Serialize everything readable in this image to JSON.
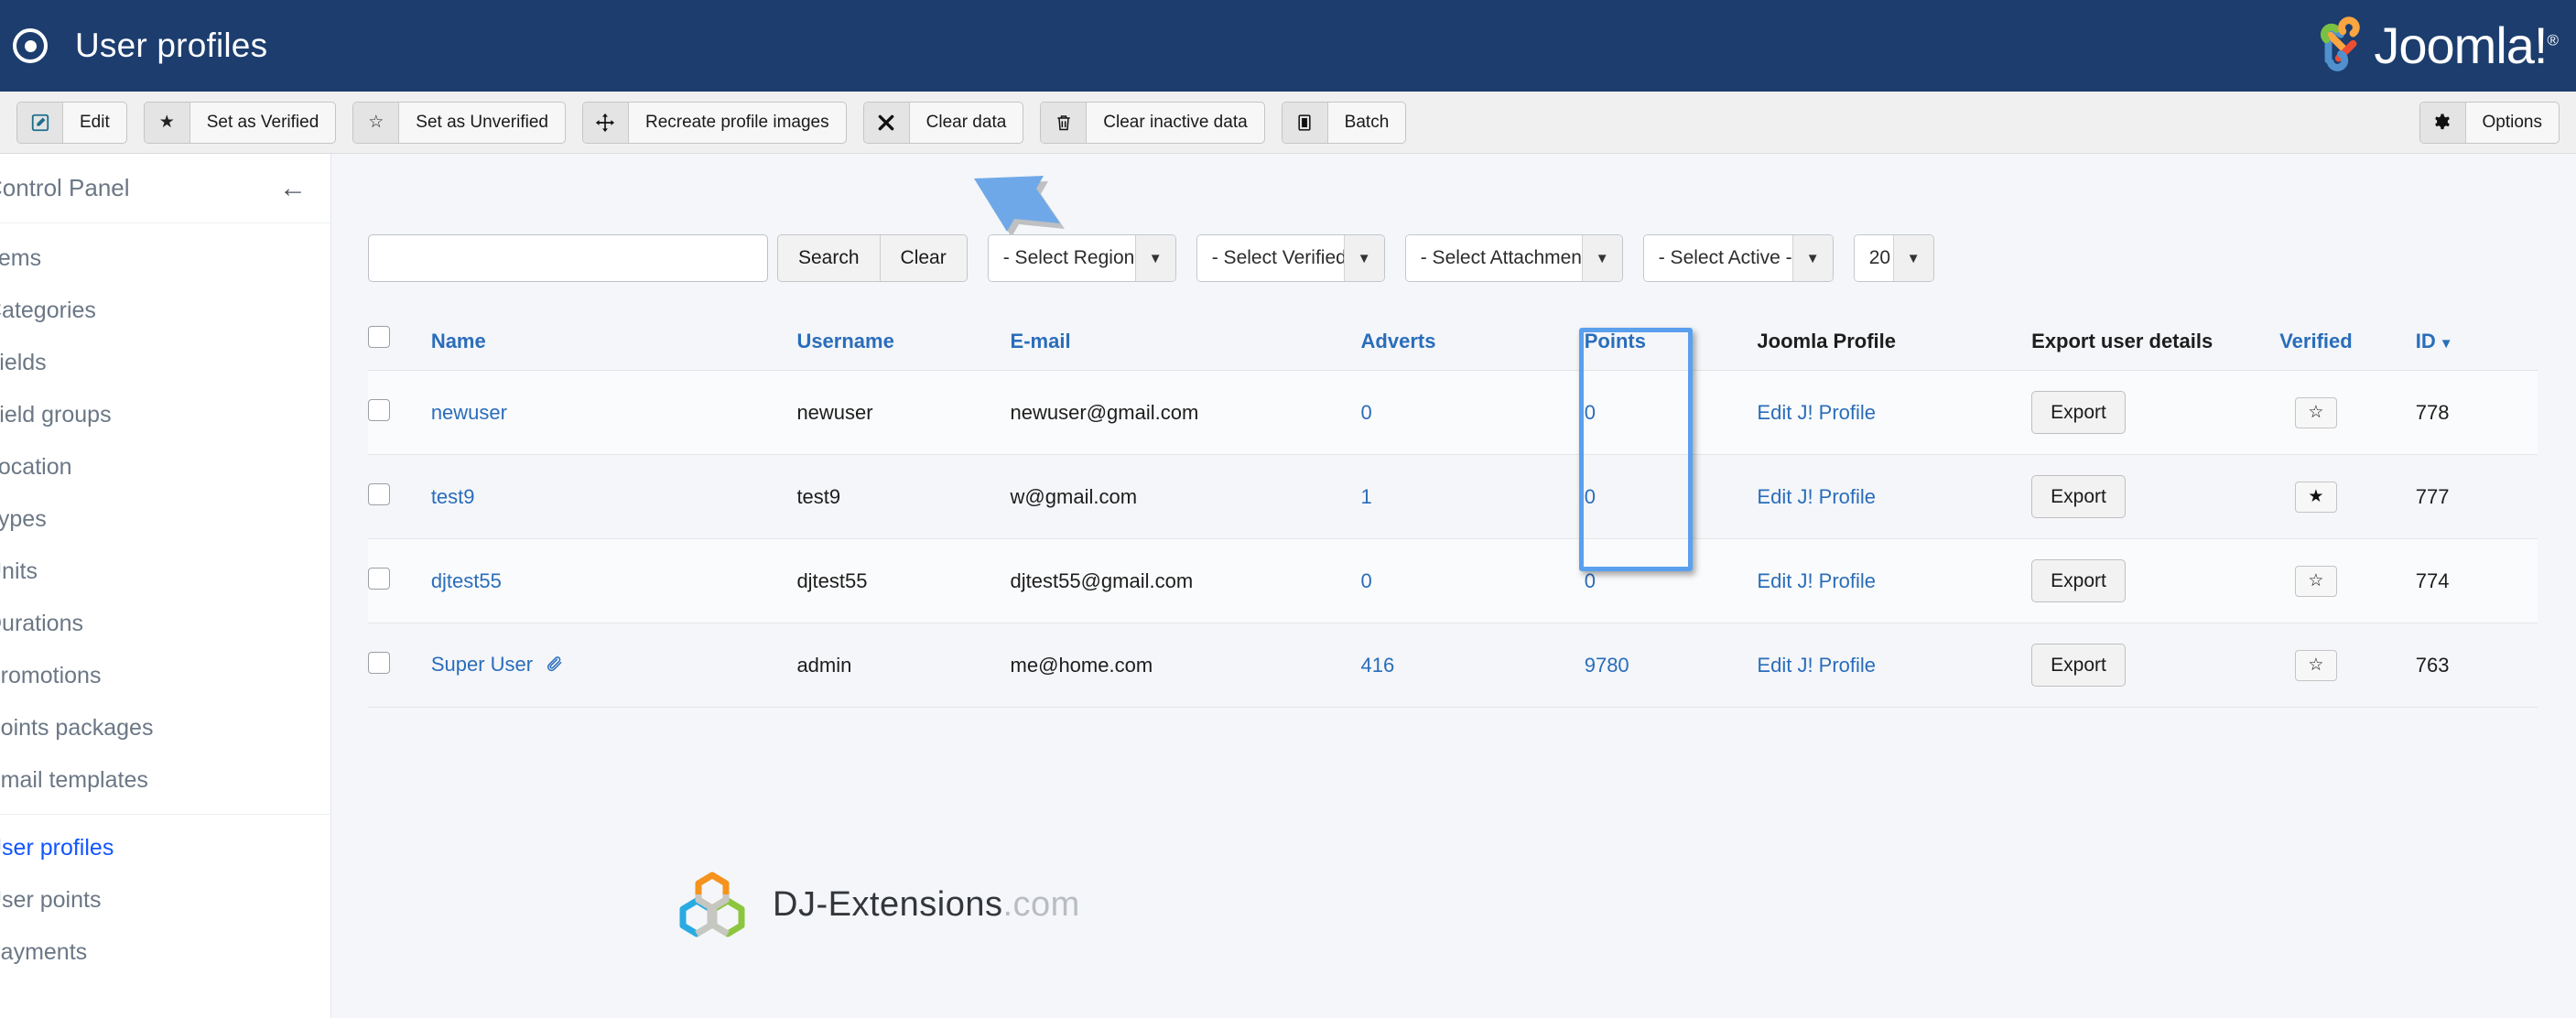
{
  "header": {
    "title": "User profiles",
    "icon": "bullseye-icon",
    "brand": "Joomla!",
    "brand_sup": "®",
    "bg_color": "#1c3d6e"
  },
  "toolbar": {
    "buttons": [
      {
        "label": "Edit",
        "icon": "pencil-square-icon",
        "glyph": "✎"
      },
      {
        "label": "Set as Verified",
        "icon": "star-filled-icon",
        "glyph": "★"
      },
      {
        "label": "Set as Unverified",
        "icon": "star-outline-icon",
        "glyph": "☆"
      },
      {
        "label": "Recreate profile images",
        "icon": "move-arrows-icon",
        "glyph": "✥"
      },
      {
        "label": "Clear data",
        "icon": "x-mark-icon",
        "glyph": "✖"
      },
      {
        "label": "Clear inactive data",
        "icon": "trash-icon",
        "glyph": "🗑"
      },
      {
        "label": "Batch",
        "icon": "batch-square-icon",
        "glyph": "▣"
      }
    ],
    "options": {
      "label": "Options",
      "icon": "gear-icon",
      "glyph": "⚙"
    }
  },
  "sidebar": {
    "control_panel": {
      "label": "Control Panel",
      "back_icon": "arrow-left-icon",
      "back_glyph": "←"
    },
    "items": [
      {
        "label": "Items",
        "active": false
      },
      {
        "label": "Categories",
        "active": false
      },
      {
        "label": "Fields",
        "active": false
      },
      {
        "label": "Field groups",
        "active": false
      },
      {
        "label": "Location",
        "active": false
      },
      {
        "label": "Types",
        "active": false
      },
      {
        "label": "Units",
        "active": false
      },
      {
        "label": "Durations",
        "active": false
      },
      {
        "label": "Promotions",
        "active": false
      },
      {
        "label": "Points packages",
        "active": false
      },
      {
        "label": "Email templates",
        "active": false
      }
    ],
    "items2": [
      {
        "label": "User profiles",
        "active": true
      },
      {
        "label": "User points",
        "active": false
      },
      {
        "label": "Payments",
        "active": false
      }
    ],
    "active_color": "#1155ff"
  },
  "filters": {
    "search_value": "",
    "search_placeholder": "",
    "search_button": "Search",
    "clear_button": "Clear",
    "selects": [
      {
        "name": "region",
        "value": "- Select Region -"
      },
      {
        "name": "verified",
        "value": "- Select Verified -"
      },
      {
        "name": "attachment",
        "value": "- Select Attachment -"
      },
      {
        "name": "active",
        "value": "- Select Active -"
      }
    ],
    "limit": "20",
    "arrow_annotation_color": "#6fa8e8"
  },
  "table": {
    "columns": [
      {
        "key": "check",
        "label": "",
        "sortable": false
      },
      {
        "key": "name",
        "label": "Name",
        "sortable": true
      },
      {
        "key": "username",
        "label": "Username",
        "sortable": true
      },
      {
        "key": "email",
        "label": "E-mail",
        "sortable": true
      },
      {
        "key": "adverts",
        "label": "Adverts",
        "sortable": true
      },
      {
        "key": "points",
        "label": "Points",
        "sortable": true
      },
      {
        "key": "joomla_profile",
        "label": "Joomla Profile",
        "sortable": false
      },
      {
        "key": "export",
        "label": "Export user details",
        "sortable": false
      },
      {
        "key": "verified",
        "label": "Verified",
        "sortable": true
      },
      {
        "key": "id",
        "label": "ID",
        "sortable": true,
        "sort_glyph": "▼"
      }
    ],
    "rows": [
      {
        "name": "newuser",
        "attachment": false,
        "username": "newuser",
        "email": "newuser@gmail.com",
        "adverts": "0",
        "points": "0",
        "profile_link": "Edit J! Profile",
        "export": "Export",
        "verified": false,
        "id": "778"
      },
      {
        "name": "test9",
        "attachment": false,
        "username": "test9",
        "email": "w@gmail.com",
        "adverts": "1",
        "points": "0",
        "profile_link": "Edit J! Profile",
        "export": "Export",
        "verified": true,
        "id": "777"
      },
      {
        "name": "djtest55",
        "attachment": false,
        "username": "djtest55",
        "email": "djtest55@gmail.com",
        "adverts": "0",
        "points": "0",
        "profile_link": "Edit J! Profile",
        "export": "Export",
        "verified": false,
        "id": "774"
      },
      {
        "name": "Super User",
        "attachment": true,
        "attachment_icon": "paperclip-icon",
        "attachment_glyph": "📎",
        "username": "admin",
        "email": "me@home.com",
        "adverts": "416",
        "points": "9780",
        "profile_link": "Edit J! Profile",
        "export": "Export",
        "verified": false,
        "id": "763"
      }
    ],
    "star_filled_glyph": "★",
    "star_outline_glyph": "☆",
    "highlight_color": "#5aa0ef"
  },
  "footer": {
    "brand_main": "DJ-Extensions",
    "brand_tld": ".com",
    "logo_icon": "dj-hexagons-icon",
    "colors": {
      "orange": "#f5931e",
      "blue": "#29abe2",
      "green": "#8cc63f",
      "grey": "#c6c7c1"
    }
  }
}
